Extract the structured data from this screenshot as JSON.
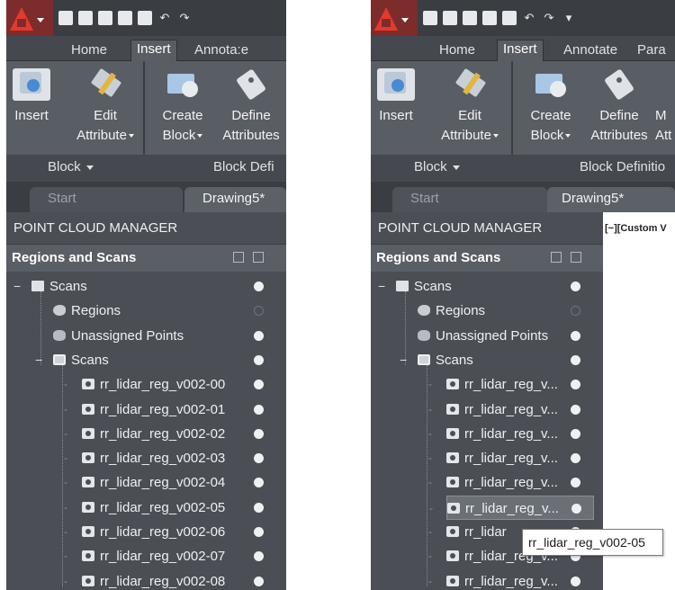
{
  "colors": {
    "accent": "#e23a2c",
    "panel": "#4b4f55",
    "ribbon": "#595d64"
  },
  "ribbon_tabs": [
    "Home",
    "Insert",
    "Annotate",
    "Parametric"
  ],
  "panel_a": {
    "tabs": [
      "Home",
      "Insert",
      "Annota:e"
    ],
    "buttons": {
      "insert": "Insert",
      "edit_1": "Edit",
      "edit_2": "Attribute",
      "create_1": "Create",
      "create_2": "Block",
      "define_1": "Define",
      "define_2": "Attributes"
    },
    "groups": {
      "block": "Block",
      "block_def": "Block Defi"
    },
    "doc_tabs": {
      "start": "Start",
      "drawing": "Drawing5*"
    }
  },
  "panel_b": {
    "tabs": [
      "Home",
      "Insert",
      "Annotate",
      "Para"
    ],
    "buttons": {
      "insert": "Insert",
      "edit_1": "Edit",
      "edit_2": "Attribute",
      "create_1": "Create",
      "create_2": "Block",
      "define_1": "Define",
      "define_2": "Attributes",
      "more_1": "M",
      "more_2": "Att"
    },
    "groups": {
      "block": "Block",
      "block_def": "Block Definitio"
    },
    "doc_tabs": {
      "start": "Start",
      "drawing": "Drawing5*"
    },
    "viewport_label": "[−][Custom V"
  },
  "palette": {
    "title": "POINT CLOUD MANAGER",
    "subtitle": "Regions and Scans"
  },
  "tree_a": [
    {
      "label": "Scans",
      "icon": "folder-icon"
    },
    {
      "label": "Regions",
      "icon": "regions-icon"
    },
    {
      "label": "Unassigned Points",
      "icon": "unassigned-points-icon"
    },
    {
      "label": "Scans",
      "icon": "scans-group-icon"
    },
    {
      "label": "rr_lidar_reg_v002-00",
      "icon": "scan-icon"
    },
    {
      "label": "rr_lidar_reg_v002-01",
      "icon": "scan-icon"
    },
    {
      "label": "rr_lidar_reg_v002-02",
      "icon": "scan-icon"
    },
    {
      "label": "rr_lidar_reg_v002-03",
      "icon": "scan-icon"
    },
    {
      "label": "rr_lidar_reg_v002-04",
      "icon": "scan-icon"
    },
    {
      "label": "rr_lidar_reg_v002-05",
      "icon": "scan-icon"
    },
    {
      "label": "rr_lidar_reg_v002-06",
      "icon": "scan-icon"
    },
    {
      "label": "rr_lidar_reg_v002-07",
      "icon": "scan-icon"
    },
    {
      "label": "rr_lidar_reg_v002-08",
      "icon": "scan-icon"
    }
  ],
  "tree_b": [
    {
      "label": "Scans"
    },
    {
      "label": "Regions"
    },
    {
      "label": "Unassigned Points"
    },
    {
      "label": "Scans"
    },
    {
      "label": "rr_lidar_reg_v..."
    },
    {
      "label": "rr_lidar_reg_v..."
    },
    {
      "label": "rr_lidar_reg_v..."
    },
    {
      "label": "rr_lidar_reg_v..."
    },
    {
      "label": "rr_lidar_reg_v..."
    },
    {
      "label": "rr_lidar_reg_v..."
    },
    {
      "label": "rr_lidar"
    },
    {
      "label": "rr_lidar_reg_v..."
    },
    {
      "label": "rr_lidar_reg_v..."
    }
  ],
  "tooltip": "rr_lidar_reg_v002-05"
}
